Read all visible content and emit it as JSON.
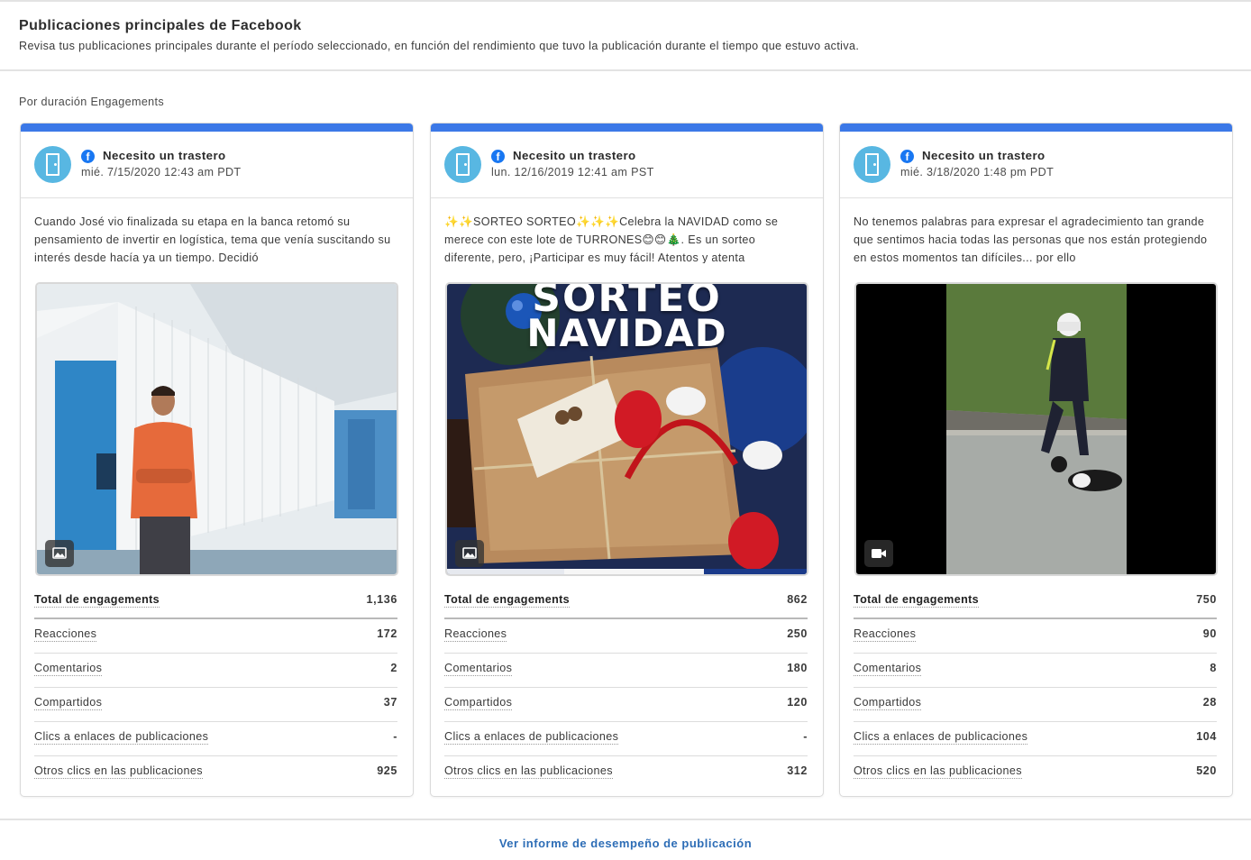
{
  "header": {
    "title": "Publicaciones principales de Facebook",
    "subtitle": "Revisa tus publicaciones principales durante el período seleccionado, en función del rendimiento que tuvo la publicación durante el tiempo que estuvo activa."
  },
  "sort_label": "Por duración Engagements",
  "colors": {
    "accent": "#3b78e7",
    "facebook": "#1877f2",
    "avatar": "#58b7e2",
    "link": "#2d6db6"
  },
  "stat_labels": {
    "total": "Total de engagements",
    "reactions": "Reacciones",
    "comments": "Comentarios",
    "shares": "Compartidos",
    "link_clicks": "Clics a enlaces de publicaciones",
    "other_clicks": "Otros clics en las publicaciones"
  },
  "posts": [
    {
      "page_name": "Necesito un trastero",
      "date": "mié. 7/15/2020 12:43 am PDT",
      "text": "Cuando José vio finalizada su etapa en la banca retomó su pensamiento de invertir en logística, tema que venía suscitando su interés desde hacía ya un tiempo. Decidió",
      "media_type_icon": "image-icon",
      "stats": {
        "total": "1,136",
        "reactions": "172",
        "comments": "2",
        "shares": "37",
        "link_clicks": "-",
        "other_clicks": "925"
      }
    },
    {
      "page_name": "Necesito un trastero",
      "date": "lun. 12/16/2019 12:41 am PST",
      "text": "✨✨SORTEO SORTEO✨✨✨Celebra la NAVIDAD como se merece con este lote de TURRONES😊😊🎄. Es un sorteo diferente, pero, ¡Participar es muy fácil! Atentos y atenta",
      "media_caption_1": "SORTEO",
      "media_caption_2": "NAVIDAD",
      "media_type_icon": "image-icon",
      "stats": {
        "total": "862",
        "reactions": "250",
        "comments": "180",
        "shares": "120",
        "link_clicks": "-",
        "other_clicks": "312"
      }
    },
    {
      "page_name": "Necesito un trastero",
      "date": "mié. 3/18/2020 1:48 pm PDT",
      "text": "No tenemos palabras para expresar el agradecimiento tan grande que sentimos hacia todas las personas que nos están protegiendo en estos momentos tan difíciles... por ello",
      "media_type_icon": "video-icon",
      "stats": {
        "total": "750",
        "reactions": "90",
        "comments": "8",
        "shares": "28",
        "link_clicks": "104",
        "other_clicks": "520"
      }
    }
  ],
  "footer_link": "Ver informe de desempeño de publicación"
}
